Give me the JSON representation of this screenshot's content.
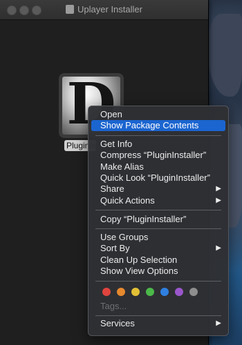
{
  "window": {
    "title": "Uplayer Installer"
  },
  "file": {
    "label": "PluginInstaller",
    "icon_letter": "D"
  },
  "menu": {
    "items": [
      {
        "label": "Open"
      },
      {
        "label": "Show Package Contents"
      },
      {
        "label": "Get Info"
      },
      {
        "label": "Compress “PluginInstaller”"
      },
      {
        "label": "Make Alias"
      },
      {
        "label": "Quick Look “PluginInstaller”"
      },
      {
        "label": "Share"
      },
      {
        "label": "Quick Actions"
      },
      {
        "label": "Copy “PluginInstaller”"
      },
      {
        "label": "Use Groups"
      },
      {
        "label": "Sort By"
      },
      {
        "label": "Clean Up Selection"
      },
      {
        "label": "Show View Options"
      },
      {
        "label": "Tags..."
      },
      {
        "label": "Services"
      }
    ],
    "highlighted": "Show Package Contents",
    "tag_colors": [
      "#e0443e",
      "#e6892e",
      "#e2c036",
      "#4cb849",
      "#2f80e0",
      "#9a57cc",
      "#8e8e8e"
    ]
  },
  "colors": {
    "highlight": "#1b65d0",
    "window_bg": "#1f1f1f"
  }
}
